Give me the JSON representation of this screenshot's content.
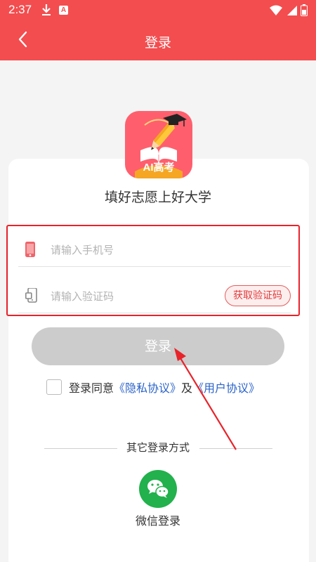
{
  "status_bar": {
    "time": "2:37",
    "download_icon": "download-icon",
    "notification_badge": "A",
    "icons": [
      "wifi-icon",
      "signal-icon",
      "battery-icon"
    ]
  },
  "nav": {
    "title": "登录",
    "back_icon": "chevron-left-icon"
  },
  "app": {
    "logo_text": "AI高考",
    "slogan": "填好志愿上好大学"
  },
  "form": {
    "phone_placeholder": "请输入手机号",
    "code_placeholder": "请输入验证码",
    "get_code_label": "获取验证码",
    "login_label": "登录"
  },
  "agreement": {
    "prefix": "登录同意",
    "privacy_link": "《隐私协议》",
    "conjunction": "及",
    "user_link": "《用户协议》",
    "checked": false
  },
  "other_login": {
    "label": "其它登录方式",
    "wechat_label": "微信登录"
  },
  "colors": {
    "primary": "#f34d4f",
    "highlight_border": "#e8232a",
    "link": "#2a63c9",
    "wechat": "#22b14c",
    "disabled_button": "#cccccc"
  }
}
